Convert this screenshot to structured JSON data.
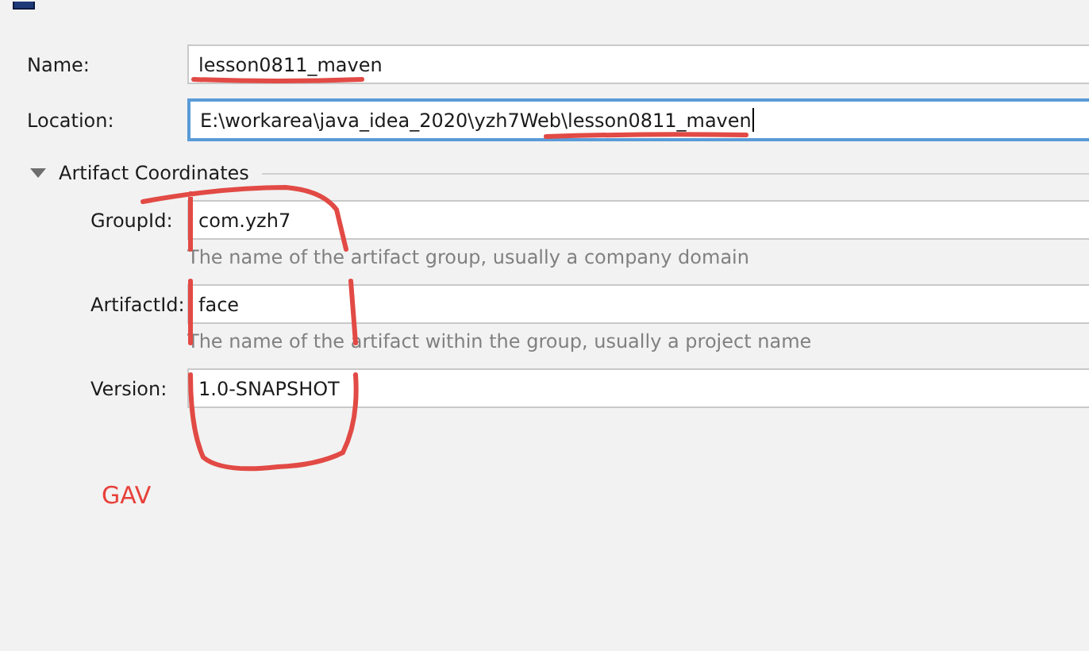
{
  "form": {
    "fields": [
      {
        "label": "Name:",
        "value": "lesson0811_maven",
        "focused": false
      },
      {
        "label": "Location:",
        "value": "E:\\workarea\\java_idea_2020\\yzh7Web\\lesson0811_maven",
        "focused": true
      }
    ]
  },
  "section": {
    "title": "Artifact Coordinates",
    "expanded": true,
    "fields": [
      {
        "label": "GroupId:",
        "value": "com.yzh7",
        "hint": "The name of the artifact group, usually a company domain"
      },
      {
        "label": "ArtifactId:",
        "value": "face",
        "hint": "The name of the artifact within the group, usually a project name"
      },
      {
        "label": "Version:",
        "value": "1.0-SNAPSHOT"
      }
    ]
  },
  "annotation": {
    "text": "GAV"
  }
}
